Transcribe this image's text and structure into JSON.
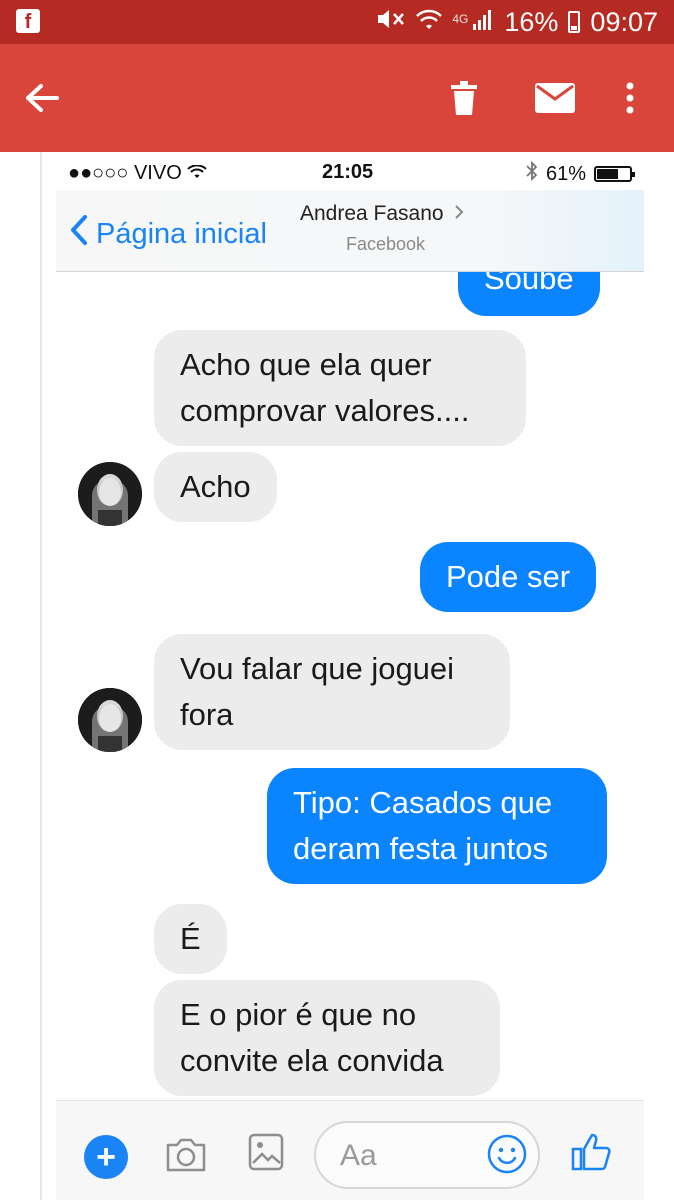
{
  "android_status": {
    "battery": "16%",
    "time": "09:07",
    "network": "4G"
  },
  "toolbar": {
    "icons": [
      "back-arrow-icon",
      "trash-icon",
      "mail-icon",
      "more-vert-icon"
    ]
  },
  "ios_status": {
    "carrier": "VIVO",
    "time": "21:05",
    "battery": "61%"
  },
  "messenger_header": {
    "back_label": "Página inicial",
    "contact_name": "Andrea Fasano",
    "contact_subtitle": "Facebook"
  },
  "messages": [
    {
      "side": "out",
      "text": "Soube"
    },
    {
      "side": "in",
      "text": "Acho que ela quer comprovar valores...."
    },
    {
      "side": "in",
      "text": "Acho"
    },
    {
      "side": "out",
      "text": "Pode ser"
    },
    {
      "side": "in",
      "text": "Vou falar que joguei fora"
    },
    {
      "side": "out",
      "text": "Tipo: Casados que deram festa juntos"
    },
    {
      "side": "in",
      "text": "É"
    },
    {
      "side": "in",
      "text": "E o pior é que no convite ela convida"
    }
  ],
  "composer": {
    "placeholder": "Aa"
  },
  "colors": {
    "android_status_bar": "#b52a22",
    "toolbar": "#d9443b",
    "outgoing_bubble": "#0a84ff",
    "incoming_bubble": "#ececec",
    "link_blue": "#1a84f4"
  }
}
